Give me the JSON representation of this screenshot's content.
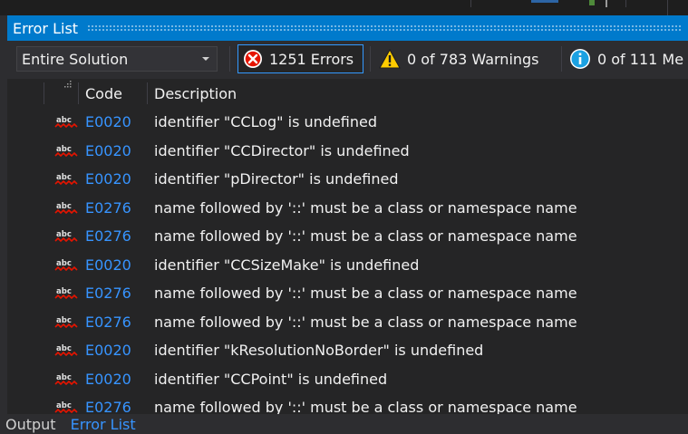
{
  "panel": {
    "title": "Error List"
  },
  "toolbar": {
    "scope_selected": "Entire Solution",
    "errors_label": "1251 Errors",
    "warnings_label": "0 of 783 Warnings",
    "messages_label": "0 of 111 Me"
  },
  "columns": {
    "code": "Code",
    "description": "Description"
  },
  "rows": [
    {
      "code": "E0020",
      "description": "identifier \"CCLog\" is undefined"
    },
    {
      "code": "E0020",
      "description": "identifier \"CCDirector\" is undefined"
    },
    {
      "code": "E0020",
      "description": "identifier \"pDirector\" is undefined"
    },
    {
      "code": "E0276",
      "description": "name followed by '::' must be a class or namespace name"
    },
    {
      "code": "E0276",
      "description": "name followed by '::' must be a class or namespace name"
    },
    {
      "code": "E0020",
      "description": "identifier \"CCSizeMake\" is undefined"
    },
    {
      "code": "E0276",
      "description": "name followed by '::' must be a class or namespace name"
    },
    {
      "code": "E0276",
      "description": "name followed by '::' must be a class or namespace name"
    },
    {
      "code": "E0020",
      "description": "identifier \"kResolutionNoBorder\" is undefined"
    },
    {
      "code": "E0020",
      "description": "identifier \"CCPoint\" is undefined"
    },
    {
      "code": "E0276",
      "description": "name followed by '::' must be a class or namespace name"
    }
  ],
  "row_icon": {
    "name": "spelling-error-icon",
    "label": "abc"
  },
  "bottom_tabs": [
    {
      "label": "Output",
      "active": false
    },
    {
      "label": "Error List",
      "active": true
    }
  ],
  "colors": {
    "accent": "#007acc",
    "link": "#3794ff",
    "error": "#e51400",
    "warning": "#ffcc00",
    "info": "#1ba1e2"
  }
}
